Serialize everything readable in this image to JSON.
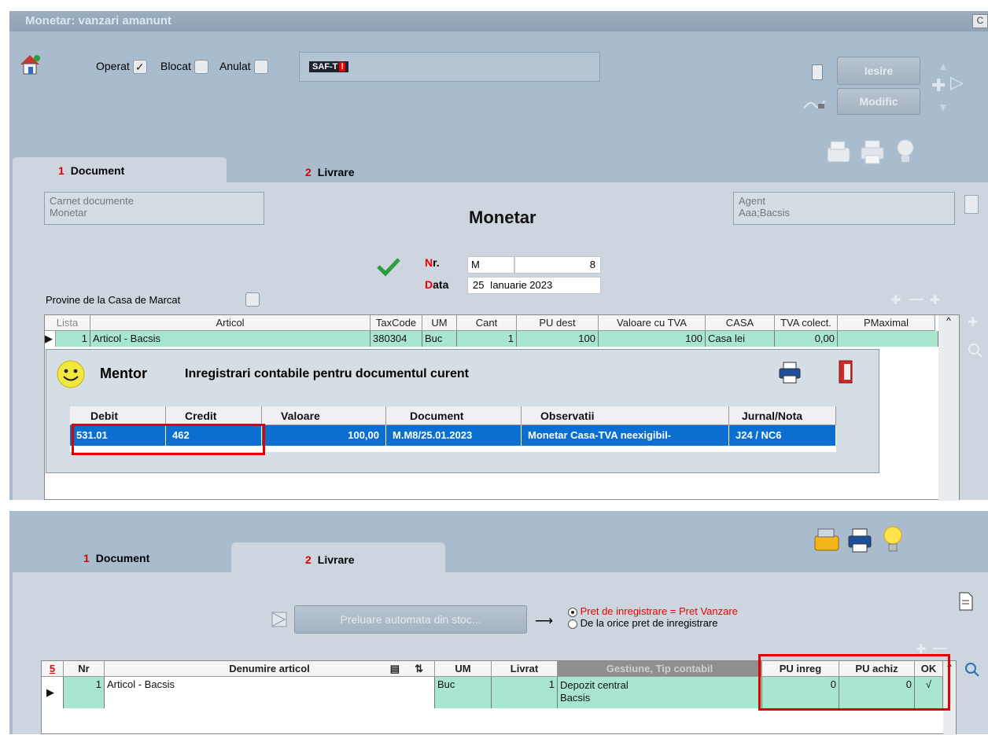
{
  "window": {
    "title": "Monetar: vanzari amanunt",
    "corner": "C"
  },
  "flags": {
    "operat": {
      "label": "Operat",
      "checked": true
    },
    "blocat": {
      "label": "Blocat",
      "checked": false
    },
    "anulat": {
      "label": "Anulat",
      "checked": false
    },
    "saft": "SAF-T"
  },
  "buttons": {
    "iesire": "Iesire",
    "modific": "Modific",
    "preluare": "Preluare automata din stoc..."
  },
  "tabs": [
    {
      "num": "1",
      "label": "Document"
    },
    {
      "num": "2",
      "label": "Livrare"
    }
  ],
  "document": {
    "carnet_label": "Carnet documente",
    "carnet_value": "Monetar",
    "heading": "Monetar",
    "agent_label": "Agent",
    "agent_value": "Aaa;Bacsis",
    "nr_label": "Nr.",
    "nr_series": "M",
    "nr_value": "8",
    "data_label": "Data",
    "data_day": "25",
    "data_rest": "Ianuarie 2023",
    "provine_label": "Provine de la Casa de Marcat"
  },
  "articles_grid": {
    "columns": [
      "Lista",
      "Articol",
      "TaxCode",
      "UM",
      "Cant",
      "PU dest",
      "Valoare cu TVA",
      "CASA",
      "TVA colect.",
      "PMaximal"
    ],
    "row": [
      "1",
      "Articol - Bacsis",
      "380304",
      "Buc",
      "1",
      "100",
      "100",
      "Casa lei",
      "0,00",
      ""
    ]
  },
  "mentor": {
    "name": "Mentor",
    "title": "Inregistrari contabile pentru documentul curent",
    "columns": [
      "Debit",
      "Credit",
      "Valoare",
      "Document",
      "Observatii",
      "Jurnal/Nota"
    ],
    "row": [
      "531.01",
      "462",
      "100,00",
      "M.M8/25.01.2023",
      "Monetar Casa-TVA neexigibil-",
      "J24 / NC6"
    ]
  },
  "livrare": {
    "radio1": "Pret de inregistrare = Pret Vanzare",
    "radio2": "De la orice pret de inregistrare",
    "grid_count": "5",
    "columns": [
      "Nr",
      "Denumire articol",
      "UM",
      "Livrat",
      "Gestiune, Tip contabil",
      "PU inreg",
      "PU achiz",
      "OK"
    ],
    "row": {
      "nr": "1",
      "denumire": "Articol - Bacsis",
      "um": "Buc",
      "livrat": "1",
      "gestiune": "Depozit central",
      "tip": "Bacsis",
      "pu_inreg": "0",
      "pu_achiz": "0",
      "ok": "√"
    }
  },
  "colors": {
    "panel": "#a9bccd",
    "grid_row": "#a8e6cf",
    "selection": "#0b6fd2",
    "highlight": "#e00000"
  }
}
